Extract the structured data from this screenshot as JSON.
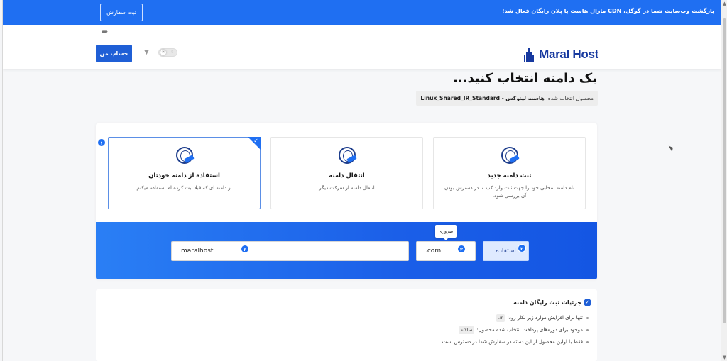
{
  "banner": {
    "message": "بازگشت وب‌سایت شما در گوگل، CDN مارال هاست با پلان رایگان فعال شد!",
    "order_button": "ثبت سفارش"
  },
  "header": {
    "logo_text": "Maral Host",
    "account_button": "حساب من",
    "icons": [
      "share-icon",
      "basket-icon",
      "sun-icon",
      "moon-icon"
    ]
  },
  "page": {
    "title": "یک دامنه انتخاب کنید...",
    "product_label": "محصول انتخاب شده:",
    "product_value": "هاست لینوکس - Linux_Shared_IR_Standard"
  },
  "options": [
    {
      "number": "۱",
      "title": "استفاده از دامنه خودتان",
      "desc": "از دامنه ای که قبلا ثبت کرده ام استفاده میکنم",
      "selected": true
    },
    {
      "title": "انتقال دامنه",
      "desc": "انتقال دامنه از شرکت دیگر",
      "selected": false
    },
    {
      "title": "ثبت دامنه جدید",
      "desc": "نام دامنه انتخابی خود را جهت ثبت وارد کنید تا در دسترس بودن آن بررسی شود.",
      "selected": false
    }
  ],
  "form": {
    "domain_value": "maralhost",
    "tld_value": ".com",
    "use_button": "استفاده",
    "required_tooltip": "ضروری",
    "badges": [
      "۲",
      "۲",
      "۲"
    ]
  },
  "details": {
    "title": "جزئیات ثبت رایگان دامنه",
    "rows": [
      {
        "text": "تنها برای افزایش موارد زیر بکار رود:",
        "tag": ".ir"
      },
      {
        "text": "موجود برای دوره‌های پرداخت انتخاب شده محصول:",
        "tag": "سالانه"
      },
      {
        "text": "فقط با اولین محصول از این دسته در سفارش شما در دسترس است.",
        "tag": ""
      }
    ]
  },
  "colors": {
    "brand_blue": "#1f6ff2",
    "logo_navy": "#17399f"
  }
}
